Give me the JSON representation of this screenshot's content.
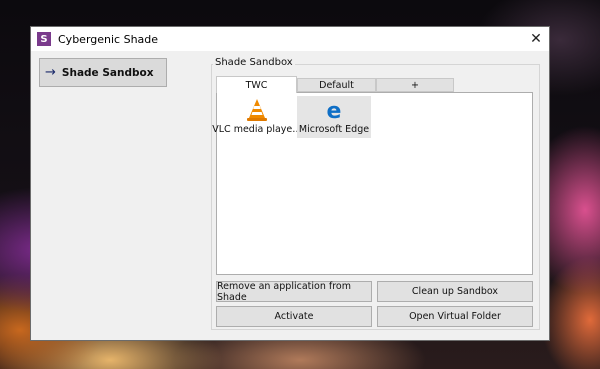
{
  "window": {
    "title": "Cybergenic Shade",
    "app_icon_letter": "S",
    "close_glyph": "✕"
  },
  "sidebar": {
    "items": [
      {
        "label": "Shade Sandbox",
        "icon": "arrow-right-icon",
        "arrow_glyph": "→"
      }
    ]
  },
  "sandbox": {
    "group_label": "Shade Sandbox",
    "tabs": [
      {
        "label": "TWC",
        "active": true
      },
      {
        "label": "Default",
        "active": false
      },
      {
        "label": "+",
        "active": false
      }
    ],
    "apps": [
      {
        "label": "VLC media playe…",
        "icon": "vlc-icon",
        "selected": false
      },
      {
        "label": "Microsoft Edge",
        "icon": "edge-icon",
        "selected": true
      }
    ]
  },
  "buttons": {
    "remove": "Remove an application from Shade",
    "cleanup": "Clean up Sandbox",
    "activate": "Activate",
    "open_folder": "Open Virtual Folder"
  },
  "colors": {
    "app_icon_bg": "#7a3a8c",
    "vlc_orange": "#f08a00",
    "edge_blue": "#0f6fc6"
  }
}
